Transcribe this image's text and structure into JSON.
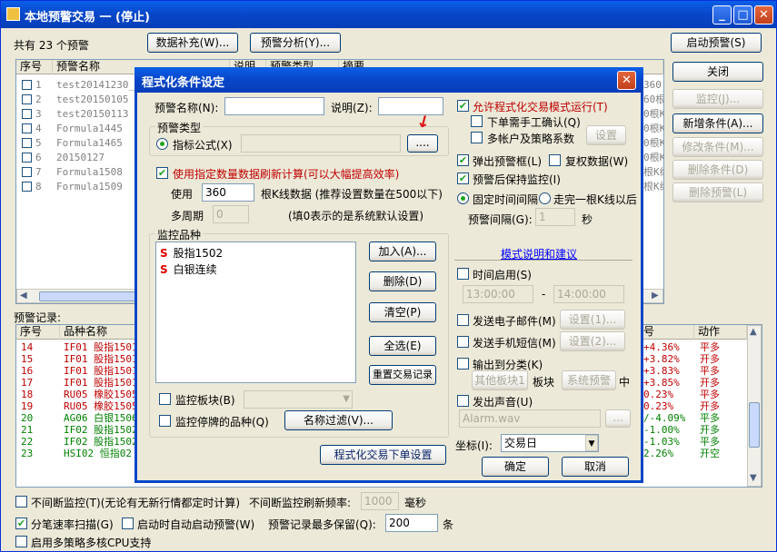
{
  "window": {
    "title": "本地预警交易 一 (停止)"
  },
  "main": {
    "total_label": "共有 23 个预警",
    "btn_supplement": "数据补充(W)...",
    "btn_analysis": "预警分析(Y)...",
    "btn_start": "启动预警(S)",
    "warn_headers": [
      "序号",
      "预警名称",
      "说明",
      "预警类型",
      "摘要"
    ],
    "warnings": [
      {
        "no": "1",
        "name": "test20141230_1"
      },
      {
        "no": "2",
        "name": "test20150105"
      },
      {
        "no": "3",
        "name": "test20150113"
      },
      {
        "no": "4",
        "name": "Formula1445"
      },
      {
        "no": "5",
        "name": "Formula1465"
      },
      {
        "no": "6",
        "name": "20150127"
      },
      {
        "no": "7",
        "name": "Formula1508"
      },
      {
        "no": "8",
        "name": "Formula1509"
      }
    ],
    "side_btns": {
      "close": "关闭",
      "monitor": "监控(J)...",
      "add": "新增条件(A)...",
      "modify": "修改条件(M)...",
      "delete_cond": "删除条件(D)",
      "delete_warn": "删除预警(L)"
    },
    "right_snips": [
      "360",
      "60根",
      "0根K",
      "0根K",
      "0根K",
      "0根K",
      "根K线",
      "根K线"
    ],
    "records_label": "预警记录:",
    "rec_headers": [
      "序号",
      "品种名称",
      "号",
      "动作"
    ],
    "records": [
      {
        "no": "14",
        "name": "IF01  股指1501",
        "pct": "+4.36%",
        "act": "平多",
        "color": "red"
      },
      {
        "no": "15",
        "name": "IF01  股指1501",
        "pct": "+3.82%",
        "act": "开多",
        "color": "red"
      },
      {
        "no": "16",
        "name": "IF01  股指1501",
        "pct": "+3.83%",
        "act": "平多",
        "color": "red"
      },
      {
        "no": "17",
        "name": "IF01  股指1501",
        "pct": "+3.85%",
        "act": "开多",
        "color": "red"
      },
      {
        "no": "18",
        "name": "RU05  橡胶1505",
        "pct": "0.23%",
        "act": "平多",
        "color": "red"
      },
      {
        "no": "19",
        "name": "RU05  橡胶1505",
        "pct": "0.23%",
        "act": "开多",
        "color": "red"
      },
      {
        "no": "20",
        "name": "AG06  白银1506",
        "pct": "/-4.09%",
        "act": "平多",
        "color": "green"
      },
      {
        "no": "21",
        "name": "IF02  股指1502",
        "pct": "-1.00%",
        "act": "开多",
        "color": "green"
      },
      {
        "no": "22",
        "name": "IF02  股指1502",
        "pct": "-1.03%",
        "act": "平多",
        "color": "green"
      },
      {
        "no": "23",
        "name": "HSI02  恒指02",
        "pct": "2.26%",
        "act": "开空",
        "color": "green"
      }
    ],
    "bottom": {
      "nonstop": "不间断监控(T)(无论有无新行情都定时计算)",
      "nonstop_freq": "不间断监控刷新频率:",
      "freq_val": "1000",
      "ms": "毫秒",
      "fast_scan": "分笔速率扫描(G)",
      "auto_start": "启动时自动启动预警(W)",
      "max_keep": "预警记录最多保留(Q):",
      "max_val": "200",
      "unit": "条",
      "multicore": "启用多策略多核CPU支持"
    }
  },
  "dialog": {
    "title": "程式化条件设定",
    "name_label": "预警名称(N):",
    "desc_label": "说明(Z):",
    "type_group": "预警类型",
    "formula_label": "指标公式(X)",
    "browse": "....",
    "use_count": "使用指定数量数据刷新计算(可以大幅提高效率)",
    "use_label": "使用",
    "use_val": "360",
    "use_hint": "根K线数据 (推荐设置数量在500以下)",
    "period_label": "多周期",
    "period_val": "0",
    "period_hint": "(填0表示的是系统默认设置)",
    "monitor_group": "监控品种",
    "items": [
      {
        "mark": "S",
        "name": "股指1502"
      },
      {
        "mark": "S",
        "name": "白银连续"
      }
    ],
    "btn_add": "加入(A)...",
    "btn_delete": "删除(D)",
    "btn_clear": "清空(P)",
    "btn_selectall": "全选(E)",
    "btn_reset": "重置交易记录",
    "monitor_block": "监控板块(B)",
    "monitor_suspended": "监控停牌的品种(Q)",
    "btn_name_filter": "名称过滤(V)...",
    "btn_prog_order": "程式化交易下单设置",
    "allow_prog": "允许程式化交易模式运行(T)",
    "manual_confirm": "下单需手工确认(Q)",
    "multi_account": "多帐户及策略系数",
    "btn_settings": "设置",
    "popup": "弹出预警框(L)",
    "reweight": "复权数据(W)",
    "keep_monitor": "预警后保持监控(I)",
    "fixed_interval": "固定时间间隔",
    "after_kline": "走完一根K线以后",
    "interval_label": "预警间隔(G):",
    "interval_val": "1",
    "seconds": "秒",
    "mode_link": "模式说明和建议",
    "time_enable": "时间启用(S)",
    "time_from": "13:00:00",
    "time_to": "14:00:00",
    "dash": "-",
    "send_email": "发送电子邮件(M)",
    "send_sms": "发送手机短信(M)",
    "btn_set1": "设置(1)...",
    "btn_set2": "设置(2)...",
    "export_cat": "输出到分类(K)",
    "other_block": "其他板块1",
    "block_label": "板块",
    "sys_warn": "系统预警",
    "zhong": "中",
    "sound": "发出声音(U)",
    "sound_file": "Alarm.wav",
    "btn_dots": "...",
    "coord_label": "坐标(I):",
    "coord_val": "交易日",
    "ok": "确定",
    "cancel": "取消"
  }
}
